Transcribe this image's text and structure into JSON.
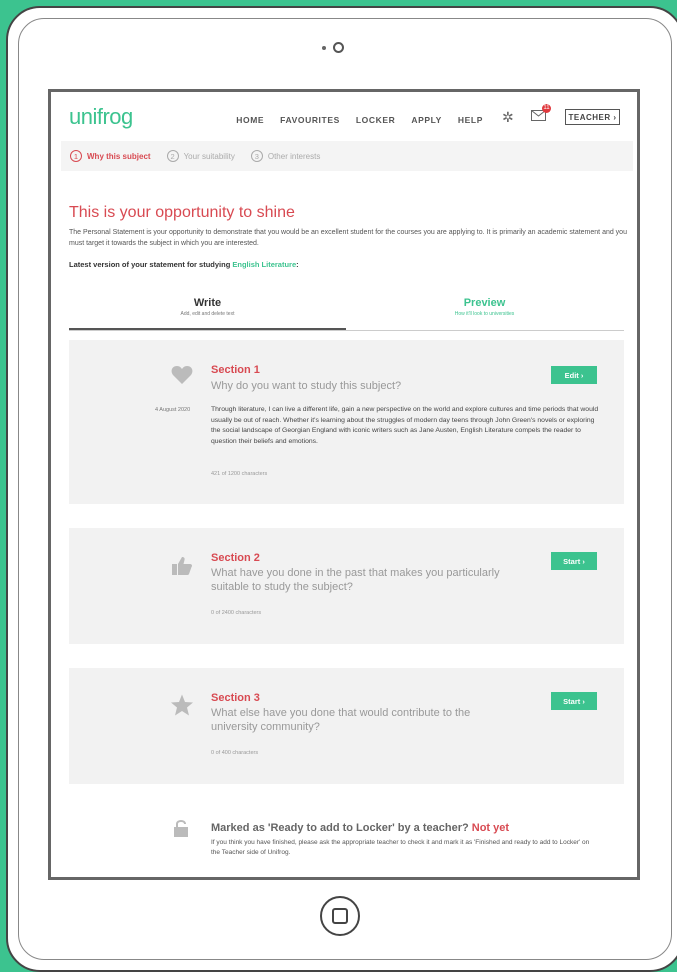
{
  "app": {
    "logo": "unifrog",
    "nav": [
      "HOME",
      "FAVOURITES",
      "LOCKER",
      "APPLY",
      "HELP"
    ],
    "mail_badge": "11",
    "teacher_label": "TEACHER ›"
  },
  "steps": [
    {
      "num": "1",
      "label": "Why this subject"
    },
    {
      "num": "2",
      "label": "Your suitability"
    },
    {
      "num": "3",
      "label": "Other interests"
    }
  ],
  "page": {
    "heading": "This is your opportunity to shine",
    "intro": "The Personal Statement is your opportunity to demonstrate that you would be an excellent student for the courses you are applying to. It is primarily an academic statement and you must target it towards the subject in which you are interested.",
    "latest_prefix": "Latest version of your statement for studying ",
    "latest_subject": "English Literature",
    "latest_suffix": ":"
  },
  "tabs": [
    {
      "title": "Write",
      "subtitle": "Add, edit and delete text"
    },
    {
      "title": "Preview",
      "subtitle": "How it'll look to universities"
    }
  ],
  "sections": [
    {
      "title": "Section 1",
      "question": "Why do you want to study this subject?",
      "button": "Edit ›",
      "date": "4 August 2020",
      "body": "Through literature, I can live a different life, gain a new perspective on the world and explore cultures and time periods that would usually be out of reach. Whether it's learning about the struggles of modern day teens through John Green's novels or exploring the social landscape of Georgian England with iconic writers such as Jane Austen, English Literature compels the reader to question their beliefs and emotions.",
      "count": "421 of 1200 characters"
    },
    {
      "title": "Section 2",
      "question": "What have you done in the past that makes you particularly suitable to study the subject?",
      "button": "Start ›",
      "count": "0 of 2400 characters"
    },
    {
      "title": "Section 3",
      "question": "What else have you done that would contribute to the university community?",
      "button": "Start ›",
      "count": "0 of 400 characters"
    }
  ],
  "ready": {
    "label": "Marked as 'Ready to add to Locker' by a teacher? ",
    "status": "Not yet",
    "text": "If you think you have finished, please ask the appropriate teacher to check it and mark it as 'Finished and ready to add to Locker' on the Teacher side of Unifrog."
  },
  "colors": {
    "accent": "#3cc38f",
    "alert": "#d84a52"
  }
}
